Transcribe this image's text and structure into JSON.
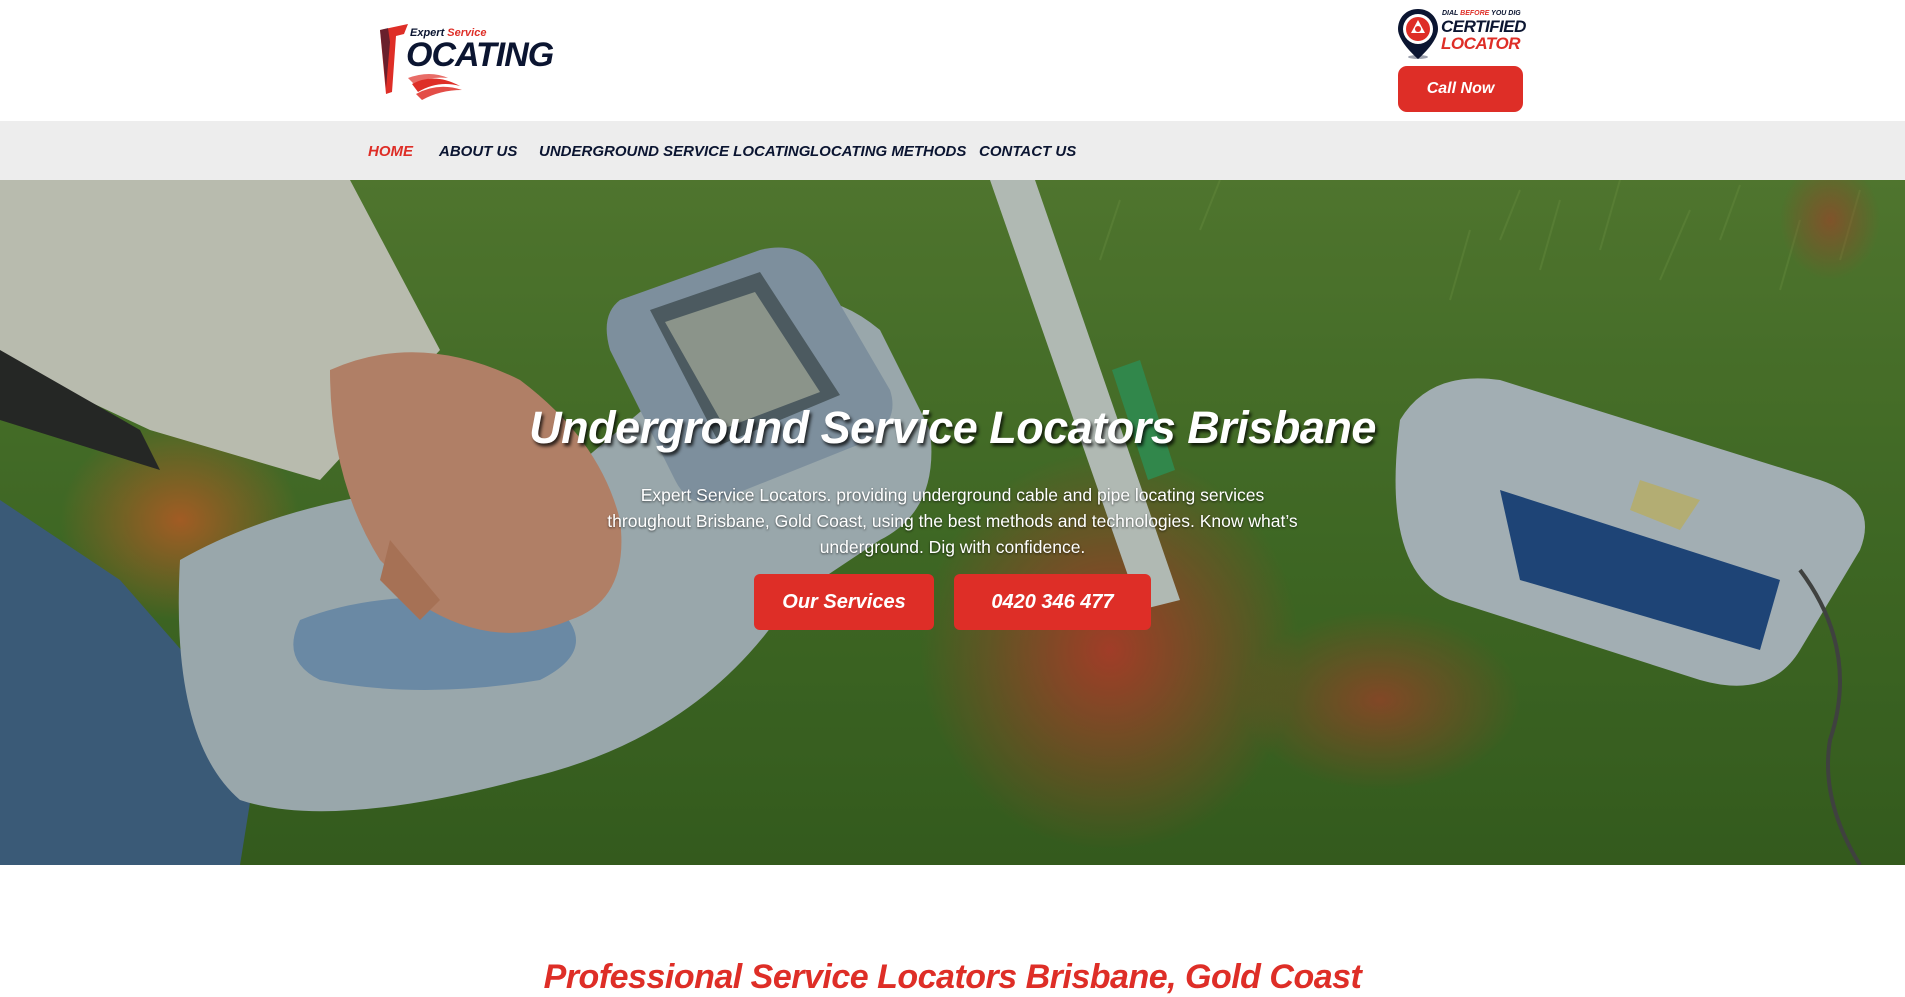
{
  "header": {
    "logo": {
      "tagline_prefix": "Expert ",
      "tagline_highlight": "Service",
      "wordmark": "OCATING",
      "icon": "l-swoosh-logo-icon"
    },
    "badge": {
      "small_prefix": "DIAL ",
      "small_highlight": "BEFORE",
      "small_suffix": " YOU DIG",
      "line1": "CERTIFIED",
      "line2": "LOCATOR",
      "icon": "location-pin-icon"
    },
    "call_button": "Call Now"
  },
  "nav": {
    "items": [
      {
        "label": "HOME",
        "active": true
      },
      {
        "label": "ABOUT US",
        "active": false
      },
      {
        "label": "UNDERGROUND SERVICE LOCATING",
        "active": false
      },
      {
        "label": "LOCATING METHODS",
        "active": false
      },
      {
        "label": "CONTACT US",
        "active": false
      }
    ]
  },
  "hero": {
    "title": "Underground Service Locators Brisbane",
    "text": "Expert Service Locators. providing underground cable and pipe locating services throughout Brisbane, Gold Coast, using the best methods and technologies. Know what’s underground. Dig with confidence.",
    "primary_button": "Our Services",
    "phone_button": "0420 346 477"
  },
  "next_section": {
    "title": "Professional Service Locators Brisbane, Gold Coast"
  },
  "colors": {
    "accent_red": "#de2e27",
    "navy": "#0b1531",
    "nav_bg": "#ededed"
  }
}
